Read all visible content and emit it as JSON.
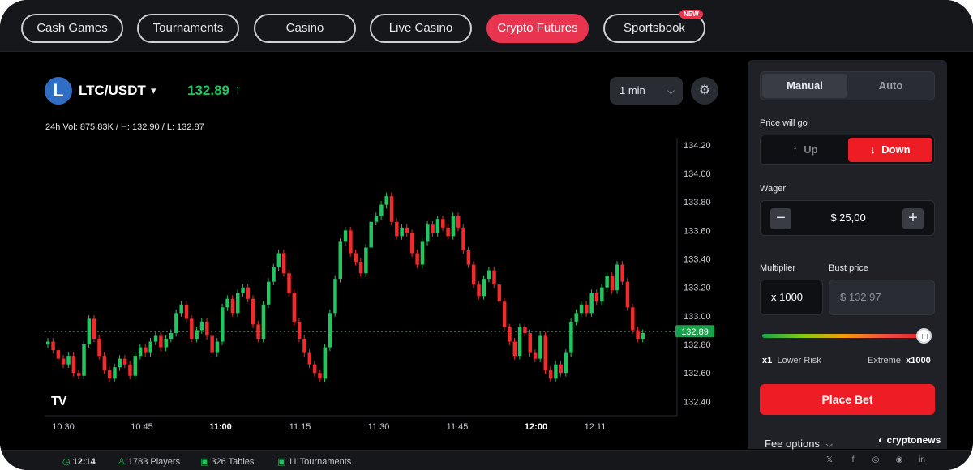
{
  "nav": {
    "items": [
      {
        "label": "Cash Games"
      },
      {
        "label": "Tournaments"
      },
      {
        "label": "Casino"
      },
      {
        "label": "Live Casino"
      },
      {
        "label": "Crypto Futures",
        "active": true
      },
      {
        "label": "Sportsbook"
      }
    ],
    "new_badge": "NEW"
  },
  "market": {
    "coin_icon": "L",
    "pair": "LTC/USDT",
    "price": "132.89",
    "price_arrow": "↑",
    "stats": "24h Vol: 875.83K / H: 132.90 / L: 132.87",
    "interval": "1 min",
    "chart_logo": "TV"
  },
  "chart_data": {
    "type": "candlestick",
    "x_ticks": [
      "10:30",
      "10:45",
      "11:00",
      "11:15",
      "11:30",
      "11:45",
      "12:00",
      "12:11"
    ],
    "y_ticks": [
      "134.20",
      "134.00",
      "133.80",
      "133.60",
      "133.40",
      "133.20",
      "133.00",
      "132.80",
      "132.60",
      "132.40"
    ],
    "ylim": [
      132.3,
      134.25
    ],
    "current_price": "132.89",
    "up_color": "#22c55e",
    "down_color": "#ef2b2b",
    "closes": [
      132.82,
      132.76,
      132.7,
      132.66,
      132.72,
      132.6,
      132.58,
      132.8,
      132.98,
      132.84,
      132.72,
      132.62,
      132.56,
      132.64,
      132.7,
      132.66,
      132.58,
      132.72,
      132.78,
      132.74,
      132.82,
      132.86,
      132.78,
      132.84,
      132.88,
      133.02,
      133.08,
      132.98,
      132.84,
      132.9,
      132.96,
      132.86,
      132.74,
      132.82,
      133.06,
      133.12,
      133.02,
      133.16,
      133.2,
      133.12,
      132.94,
      132.84,
      133.08,
      133.24,
      133.34,
      133.44,
      133.3,
      133.16,
      132.96,
      132.84,
      132.74,
      132.66,
      132.6,
      132.56,
      132.78,
      133.02,
      133.26,
      133.52,
      133.6,
      133.44,
      133.38,
      133.3,
      133.48,
      133.66,
      133.7,
      133.78,
      133.84,
      133.66,
      133.56,
      133.62,
      133.58,
      133.44,
      133.36,
      133.52,
      133.64,
      133.58,
      133.68,
      133.62,
      133.56,
      133.7,
      133.62,
      133.46,
      133.36,
      133.22,
      133.14,
      133.26,
      133.32,
      133.22,
      133.1,
      132.92,
      132.82,
      132.72,
      132.92,
      132.88,
      132.74,
      132.7,
      132.86,
      132.62,
      132.56,
      132.66,
      132.6,
      132.74,
      132.96,
      133.02,
      133.08,
      133.02,
      133.16,
      133.1,
      133.2,
      133.28,
      133.18,
      133.36,
      133.24,
      133.06,
      132.9,
      132.84,
      132.88
    ]
  },
  "panel": {
    "tabs": [
      {
        "label": "Manual",
        "active": true
      },
      {
        "label": "Auto"
      }
    ],
    "direction_label": "Price will go",
    "up_label": "Up",
    "down_label": "Down",
    "wager_label": "Wager",
    "wager_value": "$ 25,00",
    "minus": "−",
    "plus": "+",
    "multiplier_label": "Multiplier",
    "multiplier_value": "x 1000",
    "bust_label": "Bust price",
    "bust_value": "$ 132.97",
    "multiplier_level": 1.0,
    "risk_low_mult": "x1",
    "risk_low_label": "Lower Risk",
    "risk_high_label": "Extreme",
    "risk_high_mult": "x1000",
    "place_bet": "Place Bet",
    "fee_options": "Fee options"
  },
  "footer": {
    "time": "12:14",
    "players": "1783 Players",
    "tables": "326 Tables",
    "tournaments": "11 Tournaments",
    "social": [
      "𝕏",
      "f",
      "◎",
      "◉",
      "in"
    ]
  },
  "watermark": "cryptonews"
}
